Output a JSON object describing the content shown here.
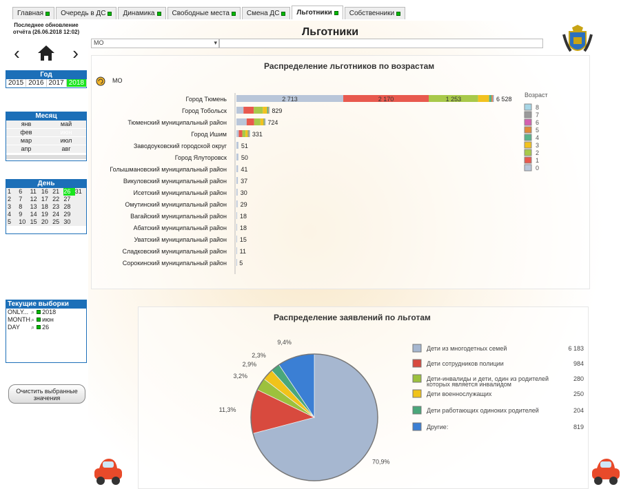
{
  "tabs": [
    {
      "label": "Главная"
    },
    {
      "label": "Очередь в ДС"
    },
    {
      "label": "Динамика"
    },
    {
      "label": "Свободные места"
    },
    {
      "label": "Смена ДС"
    },
    {
      "label": "Льготники"
    },
    {
      "label": "Собственники"
    }
  ],
  "sidebar": {
    "update_line1": "Последнее обновление",
    "update_line2": "отчёта (26.06.2018 12:02)",
    "year_title": "Год",
    "years": [
      "2015",
      "2016",
      "2017",
      "2018"
    ],
    "month_title": "Месяц",
    "months": [
      "янв",
      "май",
      "фев",
      "июн",
      "мар",
      "июл",
      "апр",
      "авг"
    ],
    "day_title": "День",
    "days": [
      "1",
      "6",
      "11",
      "16",
      "21",
      "26",
      "31",
      "2",
      "7",
      "12",
      "17",
      "22",
      "27",
      "",
      "3",
      "8",
      "13",
      "18",
      "23",
      "28",
      "",
      "4",
      "9",
      "14",
      "19",
      "24",
      "29",
      "",
      "5",
      "10",
      "15",
      "20",
      "25",
      "30",
      ""
    ],
    "current_title": "Текущие выборки",
    "current": [
      {
        "field": "ONLY...",
        "value": "2018"
      },
      {
        "field": "MONTH",
        "value": "июн"
      },
      {
        "field": "DAY",
        "value": "26"
      }
    ],
    "clear_line1": "Очистить выбранные",
    "clear_line2": "значения"
  },
  "main": {
    "title": "Льготники",
    "mo_select": "МО"
  },
  "chart1": {
    "title": "Распределение льготников по возрастам",
    "dim_label": "МО",
    "legend_title": "Возраст"
  },
  "chart2": {
    "title": "Распределение заявлений по льготам"
  },
  "chart_data": [
    {
      "type": "bar",
      "stacked": true,
      "orientation": "horizontal",
      "categories": [
        "Город Тюмень",
        "Город Тобольск",
        "Тюменский муниципальный район",
        "Город Ишим",
        "Заводоуковский городской округ",
        "Город Ялуторовск",
        "Голышмановский муниципальный район",
        "Викуловский муниципальный район",
        "Исетский муниципальный район",
        "Омутинский муниципальный район",
        "Вагайский муниципальный район",
        "Абатский муниципальный район",
        "Уватский муниципальный район",
        "Сладковский муниципальный район",
        "Сорокинский муниципальный район"
      ],
      "totals": [
        6528,
        829,
        724,
        331,
        51,
        50,
        41,
        37,
        30,
        29,
        18,
        18,
        15,
        11,
        5
      ],
      "series": [
        {
          "name": "0",
          "color": "#b9c6d9",
          "values": [
            2713,
            180,
            260,
            60,
            51,
            50,
            41,
            37,
            30,
            29,
            18,
            18,
            15,
            11,
            5
          ]
        },
        {
          "name": "1",
          "color": "#e8594e",
          "values": [
            2170,
            260,
            190,
            90,
            0,
            0,
            0,
            0,
            0,
            0,
            0,
            0,
            0,
            0,
            0
          ]
        },
        {
          "name": "2",
          "color": "#a8c94a",
          "values": [
            1253,
            230,
            160,
            80,
            0,
            0,
            0,
            0,
            0,
            0,
            0,
            0,
            0,
            0,
            0
          ]
        },
        {
          "name": "3",
          "color": "#f2c21f",
          "values": [
            280,
            110,
            80,
            60,
            0,
            0,
            0,
            0,
            0,
            0,
            0,
            0,
            0,
            0,
            0
          ]
        },
        {
          "name": "4",
          "color": "#5ab48a",
          "values": [
            60,
            30,
            20,
            20,
            0,
            0,
            0,
            0,
            0,
            0,
            0,
            0,
            0,
            0,
            0
          ]
        },
        {
          "name": "5",
          "color": "#e08a3a",
          "values": [
            30,
            10,
            10,
            10,
            0,
            0,
            0,
            0,
            0,
            0,
            0,
            0,
            0,
            0,
            0
          ]
        },
        {
          "name": "6",
          "color": "#d45fb0",
          "values": [
            10,
            5,
            2,
            6,
            0,
            0,
            0,
            0,
            0,
            0,
            0,
            0,
            0,
            0,
            0
          ]
        },
        {
          "name": "7",
          "color": "#9a9a9a",
          "values": [
            7,
            2,
            1,
            3,
            0,
            0,
            0,
            0,
            0,
            0,
            0,
            0,
            0,
            0,
            0
          ]
        },
        {
          "name": "8",
          "color": "#a7d6e6",
          "values": [
            5,
            2,
            1,
            2,
            0,
            0,
            0,
            0,
            0,
            0,
            0,
            0,
            0,
            0,
            0
          ]
        }
      ],
      "data_labels": [
        [
          "2 713",
          "2 170",
          "1 253"
        ]
      ],
      "xticks": [
        "0",
        "1 000",
        "2 000",
        "3 000",
        "4 000",
        "5 000",
        "6 000",
        "7 000"
      ],
      "xlim": [
        0,
        7000
      ],
      "legend": "right"
    },
    {
      "type": "pie",
      "slices": [
        {
          "label": "Дети из многодетных семей",
          "value": 6183,
          "pct": "70,9%",
          "color": "#a6b7d0"
        },
        {
          "label": "Дети сотрудников полиции",
          "value": 984,
          "pct": "11,3%",
          "color": "#d84a3e"
        },
        {
          "label": "Дети-инвалиды и дети, один из родителей которых является инвалидом",
          "value": 280,
          "pct": "3,2%",
          "color": "#9cc13d"
        },
        {
          "label": "Дети военнослужащих",
          "value": 250,
          "pct": "2,9%",
          "color": "#f0c31a"
        },
        {
          "label": "Дети работающих одиноких родителей",
          "value": 204,
          "pct": "2,3%",
          "color": "#4aa77a"
        },
        {
          "label": "Другие:",
          "value": 819,
          "pct": "9,4%",
          "color": "#3b7fd4"
        }
      ],
      "value_labels": [
        "6 183",
        "984",
        "280",
        "250",
        "204",
        "819"
      ],
      "legend": "right"
    }
  ]
}
